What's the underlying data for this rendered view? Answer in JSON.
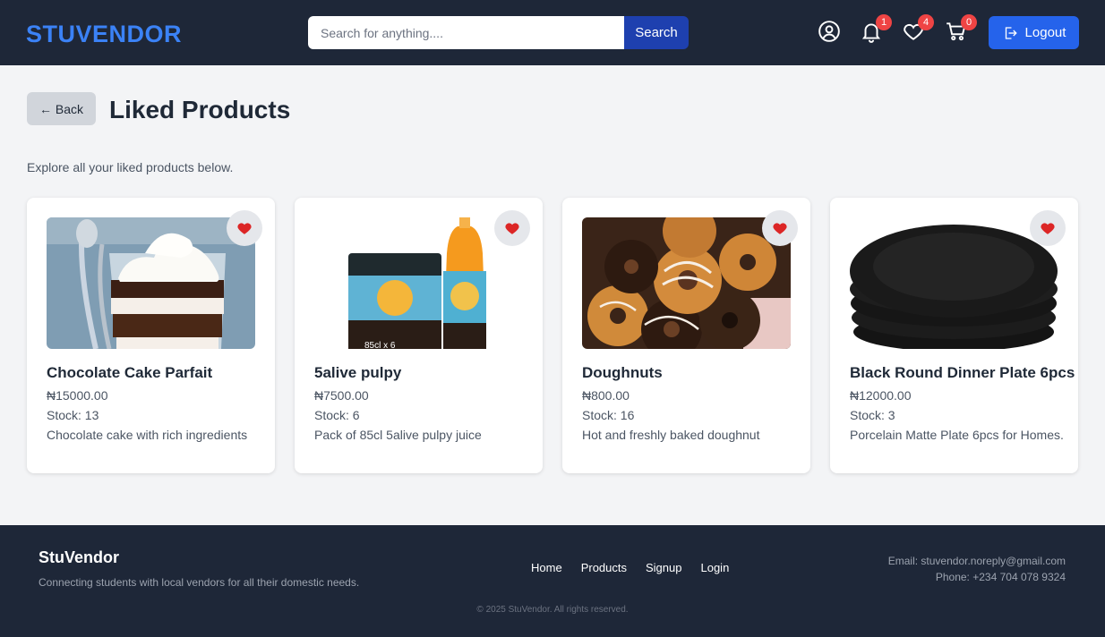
{
  "header": {
    "brand": "STUVENDOR",
    "search_placeholder": "Search for anything....",
    "search_value": "",
    "search_button": "Search",
    "notifications_count": "1",
    "likes_count": "4",
    "cart_count": "0",
    "logout_label": "Logout"
  },
  "page": {
    "back_label": "← Back",
    "title": "Liked Products",
    "intro": "Explore all your liked products below."
  },
  "products": [
    {
      "name": "Chocolate Cake Parfait",
      "price": "₦15000.00",
      "stock": "Stock: 13",
      "description": "Chocolate cake with rich ingredients"
    },
    {
      "name": "5alive pulpy",
      "price": "₦7500.00",
      "stock": "Stock: 6",
      "description": "Pack of 85cl 5alive pulpy juice",
      "pack_label": "85cl x 6"
    },
    {
      "name": "Doughnuts",
      "price": "₦800.00",
      "stock": "Stock: 16",
      "description": "Hot and freshly baked doughnut"
    },
    {
      "name": "Black Round Dinner Plate 6pcs",
      "price": "₦12000.00",
      "stock": "Stock: 3",
      "description": "Porcelain Matte Plate 6pcs for Homes."
    }
  ],
  "footer": {
    "brand": "StuVendor",
    "tagline": "Connecting students with local vendors for all their domestic needs.",
    "nav": [
      "Home",
      "Products",
      "Signup",
      "Login"
    ],
    "email": "Email: stuvendor.noreply@gmail.com",
    "phone": "Phone: +234 704 078 9324",
    "copyright": "© 2025 StuVendor. All rights reserved."
  },
  "colors": {
    "header_bg": "#1e2738",
    "brand": "#3b82f6",
    "primary_button": "#2563eb",
    "search_button": "#1e40af",
    "badge": "#ef4444",
    "heart": "#dc2626"
  }
}
